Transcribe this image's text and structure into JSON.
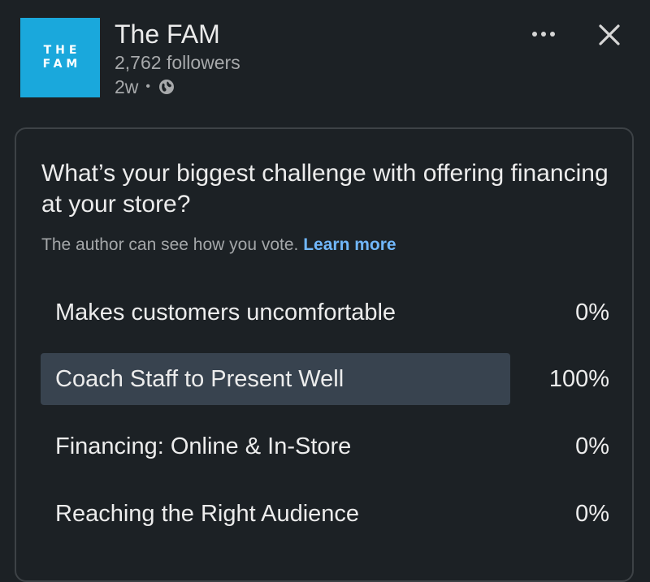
{
  "post": {
    "logo_lines": [
      "THE",
      "FAM"
    ],
    "company_name": "The FAM",
    "followers": "2,762 followers",
    "age": "2w",
    "separator": "•",
    "visibility_icon": "globe-icon",
    "more_icon": "ellipsis-icon",
    "close_icon": "close-icon"
  },
  "poll": {
    "question": "What’s your biggest challenge with offering financing at your store?",
    "disclaimer": "The author can see how you vote.",
    "learn_more": "Learn more",
    "options": [
      {
        "label": "Makes customers uncomfortable",
        "percent": "0%",
        "fraction": 0
      },
      {
        "label": "Coach Staff to Present Well",
        "percent": "100%",
        "fraction": 1
      },
      {
        "label": "Financing: Online & In-Store",
        "percent": "0%",
        "fraction": 0
      },
      {
        "label": "Reaching the Right Audience",
        "percent": "0%",
        "fraction": 0
      }
    ]
  },
  "colors": {
    "background": "#1c2125",
    "logo": "#1aa8dc",
    "link": "#71b7fb",
    "result_fill": "#38434f"
  }
}
